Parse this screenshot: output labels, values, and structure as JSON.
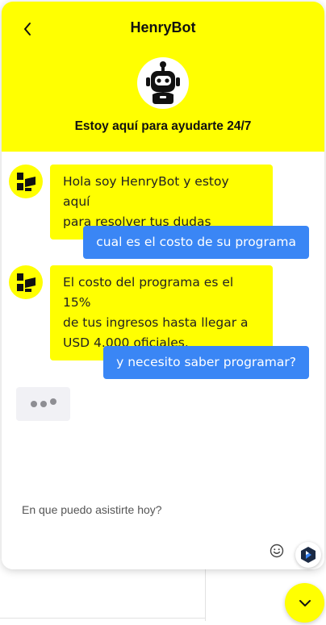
{
  "header": {
    "title": "HenryBot",
    "subtitle": "Estoy aquí para ayudarte 24/7",
    "bg_color": "#ffff01"
  },
  "messages": [
    {
      "sender": "bot",
      "lines": [
        "Hola soy HenryBot y estoy aquí",
        "para resolver tus dudas"
      ]
    },
    {
      "sender": "user",
      "text": "cual es el costo de su programa"
    },
    {
      "sender": "bot",
      "lines": [
        "El costo del programa es el 15%",
        "de tus ingresos hasta llegar a",
        "USD 4.000 oficiales."
      ]
    },
    {
      "sender": "user",
      "text": "y necesito saber programar?"
    }
  ],
  "typing_indicator": true,
  "input": {
    "placeholder": "En que puedo asistirte hoy?",
    "value": ""
  },
  "icons": {
    "back": "chevron-left-icon",
    "bot_avatar": "robot-icon",
    "message_avatar": "henry-logo-icon",
    "emoji": "smiley-icon",
    "send": "send-icon",
    "brand": "brand-badge-icon",
    "toggle": "chevron-down-icon"
  },
  "colors": {
    "accent_yellow": "#ffff01",
    "user_bubble": "#3a86f5"
  }
}
